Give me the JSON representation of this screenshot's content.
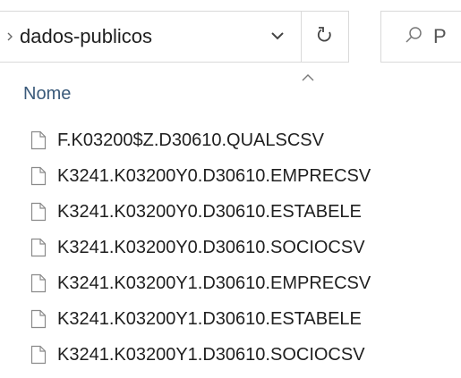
{
  "address_bar": {
    "path": "dados-publicos",
    "chevron_icon": "chevron-right-icon",
    "dropdown_icon": "chevron-down-icon",
    "refresh_icon": "refresh-icon"
  },
  "search": {
    "icon": "search-icon",
    "placeholder": "P"
  },
  "column_header": {
    "name_label": "Nome",
    "sort_icon": "sort-ascending-icon"
  },
  "files": [
    {
      "name": "F.K03200$Z.D30610.QUALSCSV"
    },
    {
      "name": "K3241.K03200Y0.D30610.EMPRECSV"
    },
    {
      "name": "K3241.K03200Y0.D30610.ESTABELE"
    },
    {
      "name": "K3241.K03200Y0.D30610.SOCIOCSV"
    },
    {
      "name": "K3241.K03200Y1.D30610.EMPRECSV"
    },
    {
      "name": "K3241.K03200Y1.D30610.ESTABELE"
    },
    {
      "name": "K3241.K03200Y1.D30610.SOCIOCSV"
    }
  ]
}
